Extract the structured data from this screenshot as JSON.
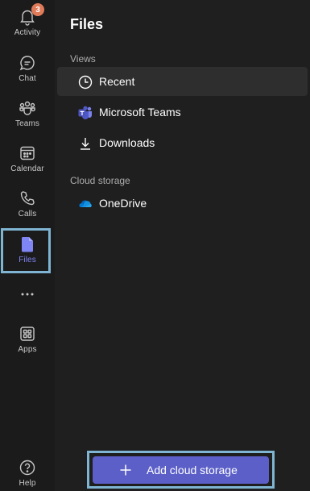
{
  "rail": {
    "activity": {
      "label": "Activity",
      "badge": "3"
    },
    "chat": {
      "label": "Chat"
    },
    "teams": {
      "label": "Teams"
    },
    "calendar": {
      "label": "Calendar"
    },
    "calls": {
      "label": "Calls"
    },
    "files": {
      "label": "Files"
    },
    "apps": {
      "label": "Apps"
    },
    "help": {
      "label": "Help"
    }
  },
  "panel": {
    "title": "Files",
    "views_header": "Views",
    "views": [
      {
        "label": "Recent",
        "icon": "clock-icon",
        "selected": true
      },
      {
        "label": "Microsoft Teams",
        "icon": "teams-logo-icon"
      },
      {
        "label": "Downloads",
        "icon": "download-icon"
      }
    ],
    "cloud_header": "Cloud storage",
    "cloud": [
      {
        "label": "OneDrive",
        "icon": "onedrive-icon"
      }
    ],
    "add_button": "Add cloud storage"
  },
  "colors": {
    "accent": "#5b5fc7",
    "active_rail": "#7f85f5",
    "badge": "#e07b5a",
    "highlight_outline": "#7fb5d3"
  }
}
